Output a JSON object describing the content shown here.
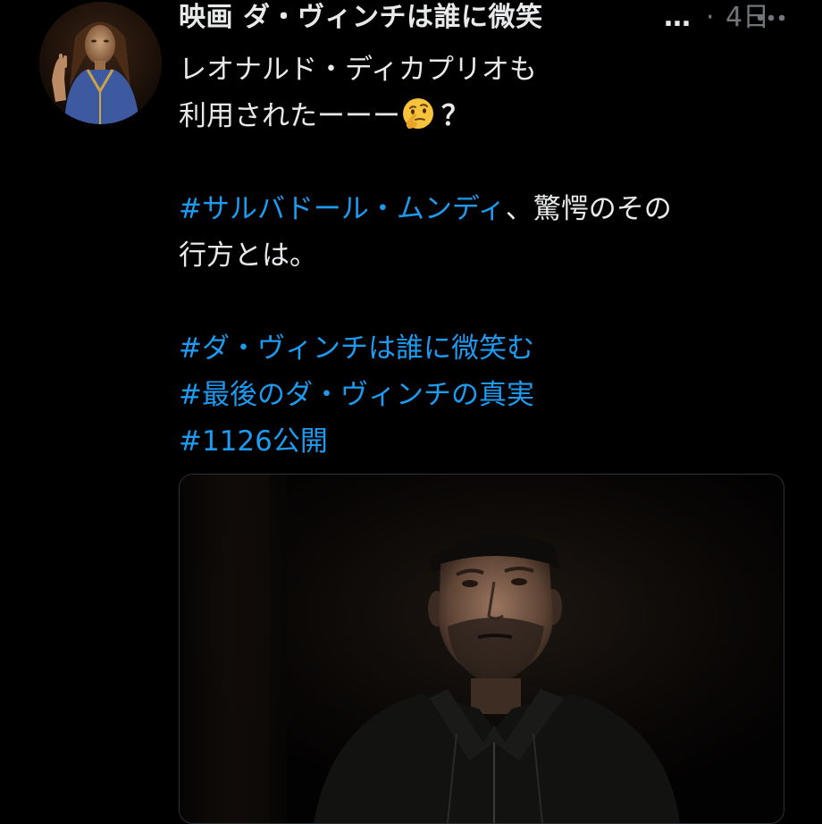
{
  "tweet": {
    "display_name": "映画 ダ・ヴィンチは誰に微笑",
    "ellipsis": "…",
    "dot": "·",
    "timestamp": "4日",
    "more_icon": "more-horizontal-icon",
    "avatar_icon": "salvator-mundi-painting",
    "lines": {
      "l1": "レオナルド・ディカプリオも",
      "l2": "利用されたーーー",
      "l2_emoji": "thinking-face-icon",
      "l2_qmark": "？",
      "h1": "#サルバドール・ムンディ",
      "l3_rest": "、驚愕のその",
      "l4": "行方とは。",
      "h2": "#ダ・ヴィンチは誰に微笑む",
      "h3": "#最後のダ・ヴィンチの真実",
      "h4": "#1126公開"
    },
    "media": {
      "description_icon": "video-still-photo"
    }
  },
  "colors": {
    "background": "#000000",
    "text": "#e7e9ea",
    "secondary": "#71767b",
    "link": "#1d9bf0",
    "border": "#2f3336"
  }
}
